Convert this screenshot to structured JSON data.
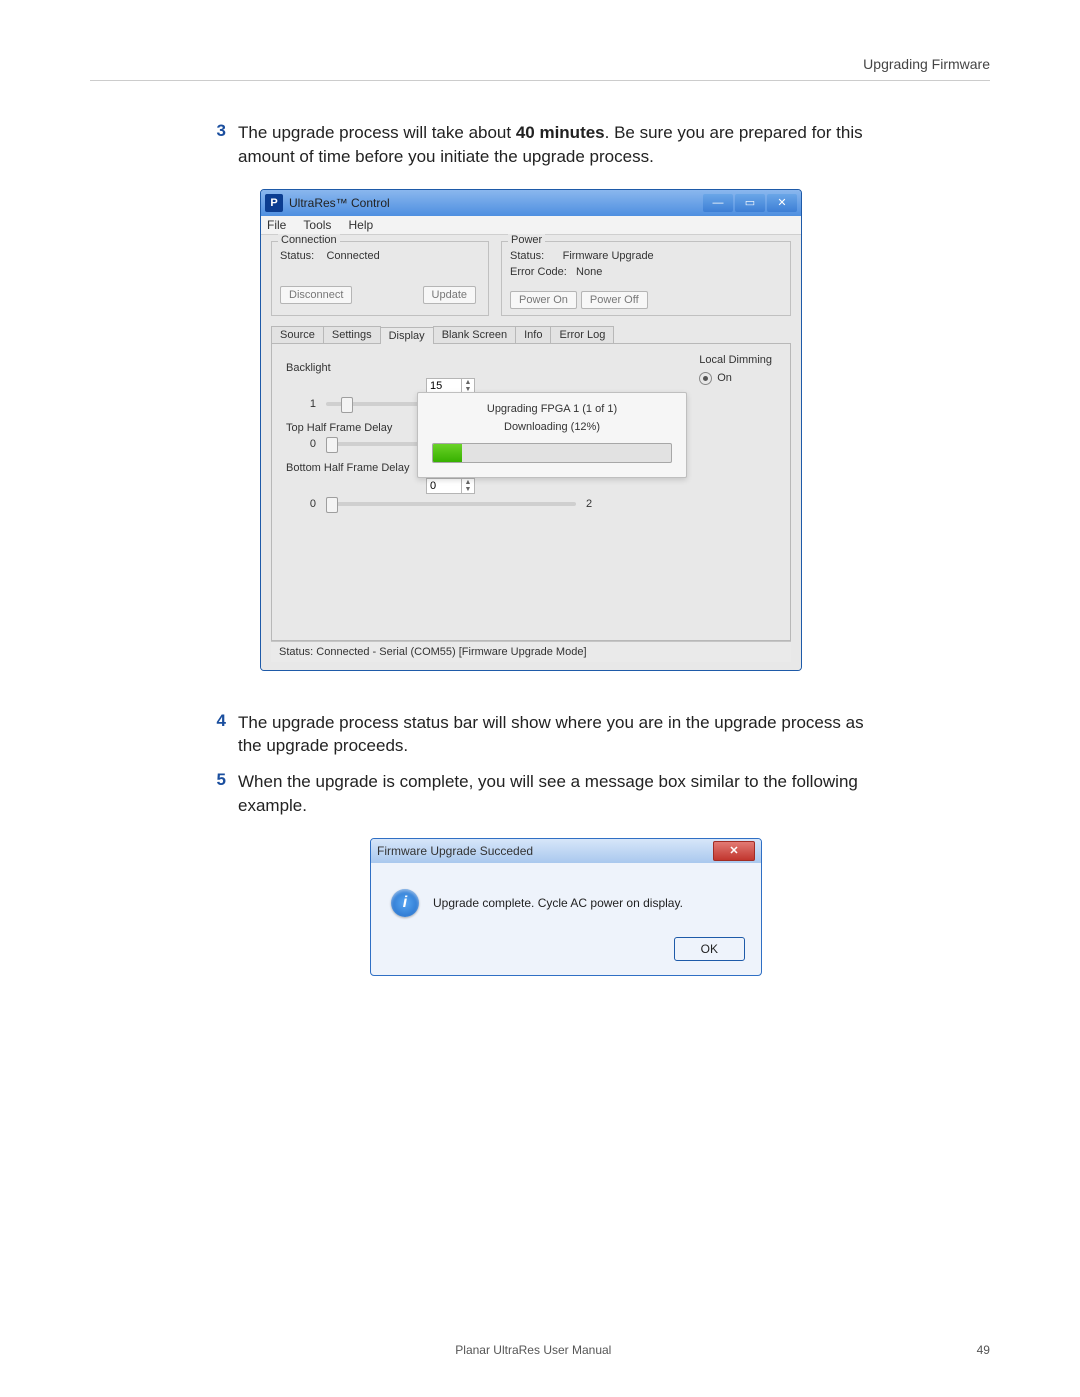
{
  "header_title": "Upgrading Firmware",
  "steps": {
    "s3_num": "3",
    "s3_a": "The upgrade process will take about ",
    "s3_bold": "40 minutes",
    "s3_b": ". Be sure you are prepared for this amount of time before you initiate the upgrade process.",
    "s4_num": "4",
    "s4": "The upgrade process status bar will show where you are in the upgrade process as the upgrade proceeds.",
    "s5_num": "5",
    "s5": "When the upgrade is complete, you will see a message box similar to the following example."
  },
  "win": {
    "icon_letter": "P",
    "title": "UltraRes™ Control",
    "menu": {
      "file": "File",
      "tools": "Tools",
      "help": "Help"
    },
    "connection": {
      "group": "Connection",
      "status_label": "Status:",
      "status_value": "Connected",
      "disconnect": "Disconnect",
      "update": "Update"
    },
    "power": {
      "group": "Power",
      "status_label": "Status:",
      "status_value": "Firmware Upgrade",
      "error_label": "Error Code:",
      "error_value": "None",
      "power_on": "Power On",
      "power_off": "Power Off"
    },
    "tabs": {
      "source": "Source",
      "settings": "Settings",
      "display": "Display",
      "blank": "Blank Screen",
      "info": "Info",
      "error": "Error Log"
    },
    "display": {
      "backlight_label": "Backlight",
      "backlight_spin": "15",
      "backlight_tick": "1",
      "top_label": "Top Half Frame Delay",
      "top_tick": "0",
      "bottom_label": "Bottom Half Frame Delay",
      "bottom_spin": "0",
      "bottom_tick_l": "0",
      "bottom_tick_r": "2",
      "local_dimming_label": "Local Dimming",
      "local_dimming_on": "On"
    },
    "progress": {
      "line1": "Upgrading FPGA 1 (1 of 1)",
      "line2": "Downloading (12%)"
    },
    "statusbar": "Status:  Connected - Serial (COM55) [Firmware Upgrade Mode]"
  },
  "dialog": {
    "title": "Firmware Upgrade Succeded",
    "message": "Upgrade complete.  Cycle AC power on display.",
    "ok": "OK"
  },
  "footer": {
    "left": "Planar UltraRes User Manual",
    "right": "49"
  }
}
